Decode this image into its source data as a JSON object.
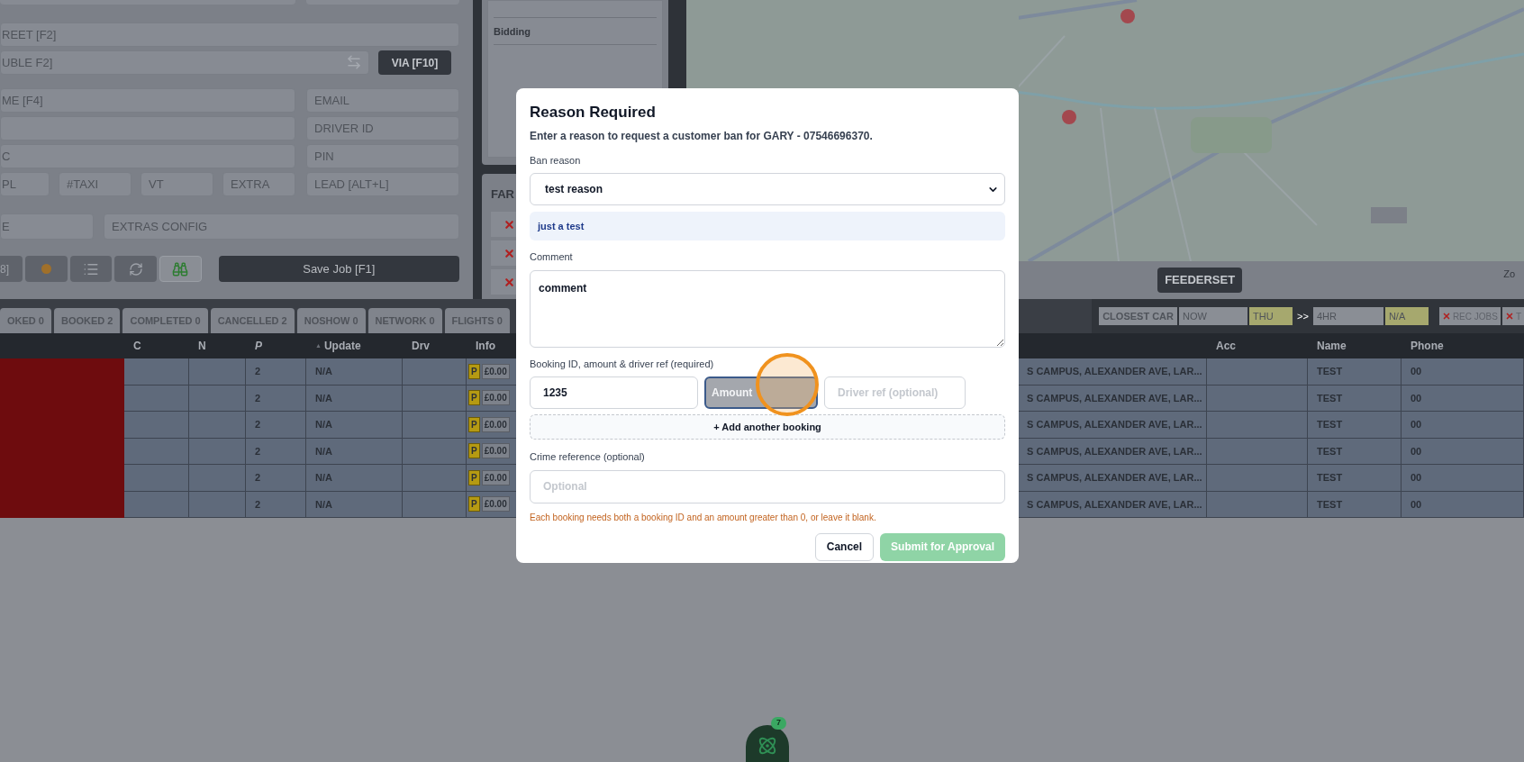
{
  "booking_form": {
    "street": {
      "placeholder": "REET [F2]"
    },
    "double": {
      "placeholder": "UBLE F2]"
    },
    "via": "VIA [F10]",
    "name": {
      "placeholder": "ME [F4]"
    },
    "email": {
      "placeholder": "EMAIL"
    },
    "driver_id": {
      "placeholder": "DRIVER ID"
    },
    "field_c": {
      "placeholder": "C"
    },
    "pin": {
      "placeholder": "PIN"
    },
    "small_fields": [
      {
        "placeholder": "PL"
      },
      {
        "placeholder": "#TAXI"
      },
      {
        "placeholder": "VT"
      },
      {
        "placeholder": "EXTRA"
      }
    ],
    "lead": {
      "placeholder": "LEAD [ALT+L]"
    },
    "field_e": {
      "placeholder": "E"
    },
    "extras": {
      "placeholder": "EXTRAS CONFIG"
    },
    "shortcut_button": "8]",
    "save": "Save Job [F1]"
  },
  "side_panel": {
    "bidding": "Bidding",
    "fare_title": "FAR"
  },
  "map_panel": {
    "feederset": "FEEDERSET",
    "zoom_label": "Zo"
  },
  "job_tabs": [
    {
      "label": "OKED 0",
      "selected": false
    },
    {
      "label": "BOOKED 2",
      "selected": false
    },
    {
      "label": "COMPLETED 0",
      "selected": false
    },
    {
      "label": "CANCELLED 2",
      "selected": false
    },
    {
      "label": "NOSHOW 0",
      "selected": false
    },
    {
      "label": "NETWORK 0",
      "selected": false
    },
    {
      "label": "FLIGHTS 0",
      "selected": false
    }
  ],
  "filters": {
    "closest_car": "CLOSEST CAR",
    "from": "NOW",
    "from_day": "THU",
    "arrow": ">>",
    "to": "4HR",
    "to_day": "N/A",
    "rec_jobs": "REC JOBS",
    "next": "T"
  },
  "table": {
    "columns_left": [
      {
        "label": "C"
      },
      {
        "label": "N"
      },
      {
        "label": "P"
      },
      {
        "label": "Update",
        "sort_mark": "▲"
      },
      {
        "label": "Drv"
      },
      {
        "label": "Info"
      }
    ],
    "columns_right": [
      {
        "label": "Acc"
      },
      {
        "label": "Name"
      },
      {
        "label": "Phone"
      }
    ],
    "rows": [
      {
        "color": "#6e0c0e",
        "p": "2",
        "update": "N/A",
        "badge": "P",
        "fare": "£0.00",
        "address": "S CAMPUS, ALEXANDER AVE, LAR...",
        "name": "TEST",
        "phone": "00"
      },
      {
        "color": "#6e0c0e",
        "p": "2",
        "update": "N/A",
        "badge": "P",
        "fare": "£0.00",
        "address": "S CAMPUS, ALEXANDER AVE, LAR...",
        "name": "TEST",
        "phone": "00"
      },
      {
        "color": "#6e0c0e",
        "p": "2",
        "update": "N/A",
        "badge": "P",
        "fare": "£0.00",
        "address": "S CAMPUS, ALEXANDER AVE, LAR...",
        "name": "TEST",
        "phone": "00"
      },
      {
        "color": "#6e0c0e",
        "p": "2",
        "update": "N/A",
        "badge": "P",
        "fare": "£0.00",
        "address": "S CAMPUS, ALEXANDER AVE, LAR...",
        "name": "TEST",
        "phone": "00"
      },
      {
        "color": "#6e0c0e",
        "p": "2",
        "update": "N/A",
        "badge": "P",
        "fare": "£0.00",
        "address": "S CAMPUS, ALEXANDER AVE, LAR...",
        "name": "TEST",
        "phone": "00"
      },
      {
        "color": "#6e0c0e",
        "p": "2",
        "update": "N/A",
        "badge": "P",
        "fare": "£0.00",
        "address": "S CAMPUS, ALEXANDER AVE, LAR...",
        "name": "TEST",
        "phone": "00"
      }
    ]
  },
  "modal": {
    "title": "Reason Required",
    "subtitle": "Enter a reason to request a customer ban for GARY - 07546696370.",
    "ban_reason_label": "Ban reason",
    "ban_reason": "test reason",
    "reason_note": "just a test",
    "comment_label": "Comment",
    "comment": "comment",
    "bookings_label": "Booking ID, amount & driver ref (required)",
    "bookings": [
      {
        "booking_id": "1235",
        "amount_placeholder": "Amount",
        "amount_focused": true,
        "driver_ref_placeholder": "Driver ref (optional)"
      }
    ],
    "add_booking": "+ Add another booking",
    "crime_label": "Crime reference (optional)",
    "crime_placeholder": "Optional",
    "error": "Each booking needs both a booking ID and an amount greater than 0, or leave it blank.",
    "cancel": "Cancel",
    "submit": {
      "label": "Submit for Approval",
      "disabled": true
    }
  },
  "assistant": {
    "badge": "7"
  }
}
